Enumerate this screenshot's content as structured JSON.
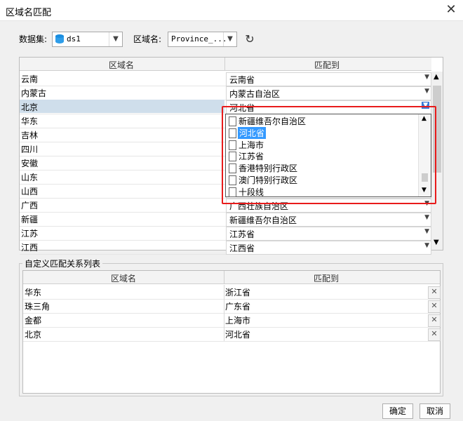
{
  "window": {
    "title": "区域名匹配",
    "close_icon": "close-icon"
  },
  "toolbar": {
    "dataset_label": "数据集:",
    "dataset_value": "ds1",
    "region_label": "区域名:",
    "region_value": "Province_...",
    "refresh_icon": "refresh-icon"
  },
  "main_table": {
    "headers": [
      "区域名",
      "匹配到"
    ],
    "rows": [
      {
        "name": "云南",
        "match": "云南省"
      },
      {
        "name": "内蒙古",
        "match": "内蒙古自治区"
      },
      {
        "name": "北京",
        "match": "河北省"
      },
      {
        "name": "华东",
        "match": ""
      },
      {
        "name": "吉林",
        "match": ""
      },
      {
        "name": "四川",
        "match": ""
      },
      {
        "name": "安徽",
        "match": ""
      },
      {
        "name": "山东",
        "match": ""
      },
      {
        "name": "山西",
        "match": ""
      },
      {
        "name": "广西",
        "match": "广西壮族自治区"
      },
      {
        "name": "新疆",
        "match": "新疆维吾尔自治区"
      },
      {
        "name": "江苏",
        "match": "江苏省"
      },
      {
        "name": "江西",
        "match": "江西省"
      }
    ],
    "selected_row": 2
  },
  "dropdown": {
    "items": [
      "新疆维吾尔自治区",
      "河北省",
      "上海市",
      "江苏省",
      "香港特别行政区",
      "澳门特别行政区",
      "十段线"
    ],
    "highlighted": 1
  },
  "custom_group": {
    "title": "自定义匹配关系列表",
    "headers": [
      "区域名",
      "匹配到"
    ],
    "rows": [
      {
        "name": "华东",
        "match": "浙江省"
      },
      {
        "name": "珠三角",
        "match": "广东省"
      },
      {
        "name": "金都",
        "match": "上海市"
      },
      {
        "name": "北京",
        "match": "河北省"
      }
    ],
    "delete_glyph": "✕"
  },
  "buttons": {
    "ok": "确定",
    "cancel": "取消"
  },
  "colors": {
    "selection": "#cfdeeb",
    "highlight": "#3399ff",
    "annotation": "#e81b1b"
  }
}
